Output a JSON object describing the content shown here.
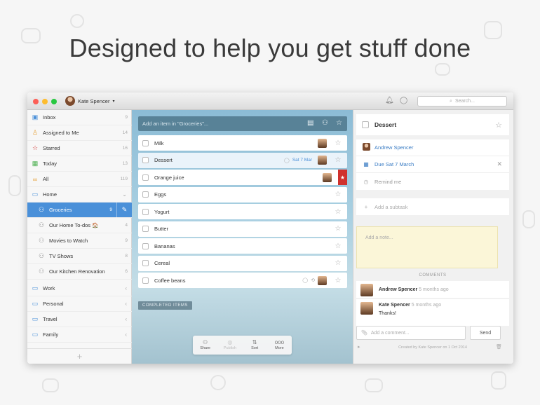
{
  "headline": "Designed to help you get stuff done",
  "colors": {
    "accent": "#4a90d9",
    "star_red": "#d0312d",
    "note_yellow": "#fbf6d8"
  },
  "titlebar": {
    "user_name": "Kate Spencer",
    "search_placeholder": "Search..."
  },
  "sidebar": {
    "smart_lists": [
      {
        "label": "Inbox",
        "count": "9",
        "icon": "inbox-icon"
      },
      {
        "label": "Assigned to Me",
        "count": "14",
        "icon": "person-icon"
      },
      {
        "label": "Starred",
        "count": "16",
        "icon": "star-icon"
      },
      {
        "label": "Today",
        "count": "13",
        "icon": "calendar-icon"
      },
      {
        "label": "All",
        "count": "119",
        "icon": "infinity-icon"
      }
    ],
    "home_folder": "Home",
    "home_lists": [
      {
        "label": "Groceries",
        "count": "9",
        "active": true
      },
      {
        "label": "Our Home To-dos 🏠",
        "count": "4"
      },
      {
        "label": "Movies to Watch",
        "count": "9"
      },
      {
        "label": "TV Shows",
        "count": "8"
      },
      {
        "label": "Our Kitchen Renovation",
        "count": "6"
      }
    ],
    "folders": [
      {
        "label": "Work"
      },
      {
        "label": "Personal"
      },
      {
        "label": "Travel"
      },
      {
        "label": "Family"
      }
    ]
  },
  "main": {
    "add_placeholder": "Add an item in \"Groceries\"...",
    "tasks": [
      {
        "title": "Milk",
        "avatar": true,
        "starred": false,
        "due": ""
      },
      {
        "title": "Dessert",
        "avatar": true,
        "starred": false,
        "due": "Sat 7 Mar",
        "selected": true
      },
      {
        "title": "Orange juice",
        "avatar": true,
        "starred": true,
        "due": ""
      },
      {
        "title": "Eggs",
        "avatar": false,
        "starred": false,
        "due": ""
      },
      {
        "title": "Yogurt",
        "avatar": false,
        "starred": false,
        "due": ""
      },
      {
        "title": "Butter",
        "avatar": false,
        "starred": false,
        "due": ""
      },
      {
        "title": "Bananas",
        "avatar": false,
        "starred": false,
        "due": ""
      },
      {
        "title": "Cereal",
        "avatar": false,
        "starred": false,
        "due": ""
      },
      {
        "title": "Coffee beans",
        "avatar": true,
        "starred": false,
        "due": ""
      }
    ],
    "completed_label": "COMPLETED ITEMS",
    "toolbar": [
      {
        "label": "Share",
        "icon": "share-icon"
      },
      {
        "label": "Publish",
        "icon": "globe-icon",
        "disabled": true
      },
      {
        "label": "Sort",
        "icon": "sort-icon"
      },
      {
        "label": "More",
        "icon": "more-icon"
      }
    ]
  },
  "detail": {
    "title": "Dessert",
    "assignee": "Andrew Spencer",
    "due": "Due Sat 7 March",
    "remind": "Remind me",
    "subtask_placeholder": "Add a subtask",
    "note_placeholder": "Add a note...",
    "comments_label": "COMMENTS",
    "comments": [
      {
        "name": "Andrew Spencer",
        "time": "5 months ago",
        "text": ""
      },
      {
        "name": "Kate Spencer",
        "time": "5 months ago",
        "text": "Thanks!"
      }
    ],
    "comment_placeholder": "Add a comment...",
    "send_label": "Send",
    "created": "Created by Kate Spencer on 1 Oct 2014"
  }
}
